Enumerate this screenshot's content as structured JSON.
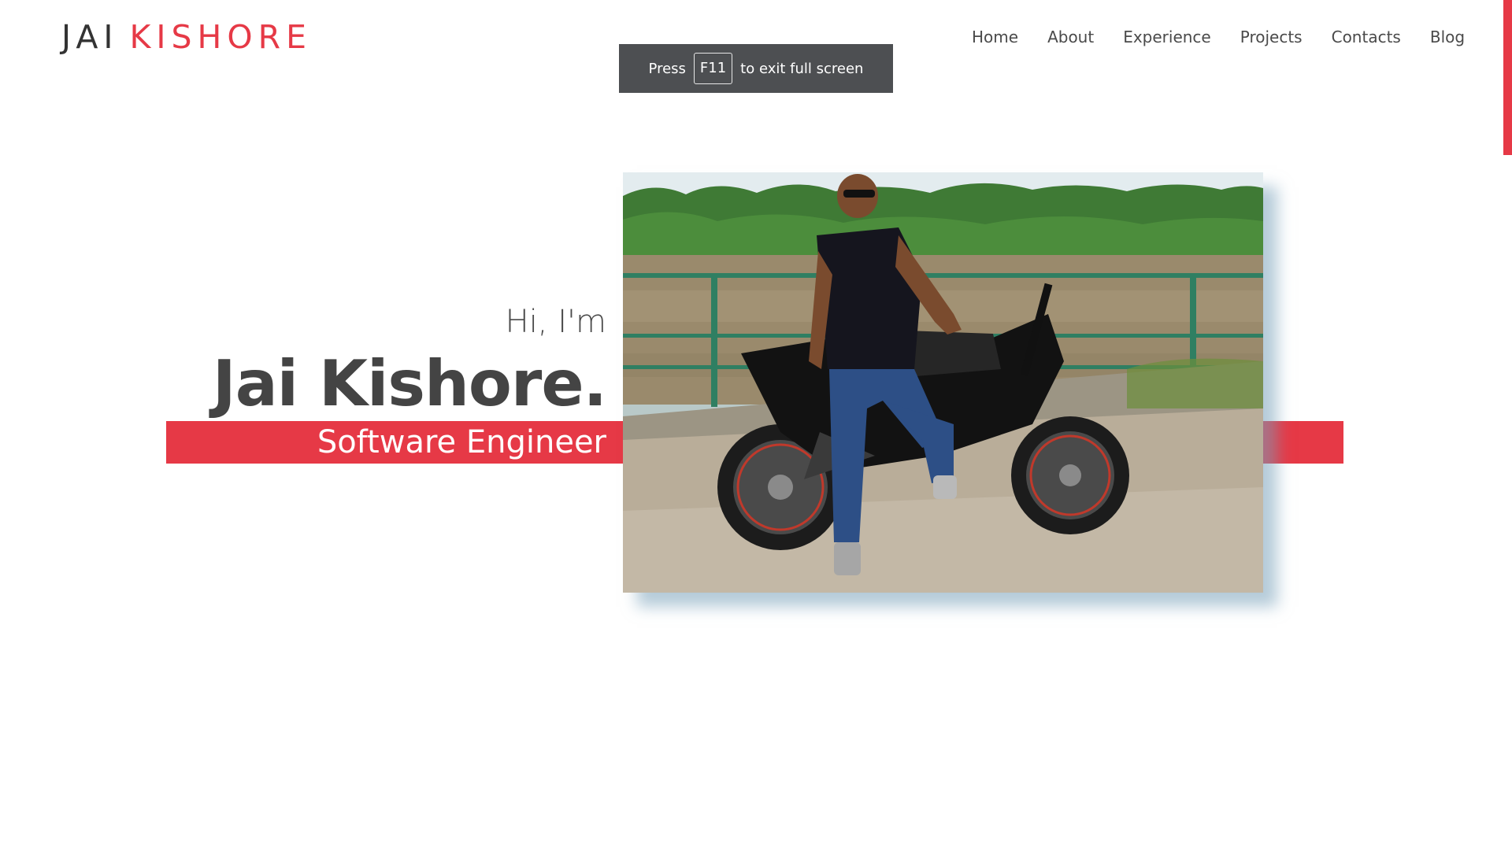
{
  "brand": {
    "first": "JAI",
    "last": "KISHORE"
  },
  "nav": {
    "items": [
      {
        "label": "Home"
      },
      {
        "label": "About"
      },
      {
        "label": "Experience"
      },
      {
        "label": "Projects"
      },
      {
        "label": "Contacts"
      },
      {
        "label": "Blog"
      }
    ]
  },
  "fullscreen_toast": {
    "before": "Press",
    "key": "F11",
    "after": "to exit full screen"
  },
  "hero": {
    "greeting": "Hi, I'm",
    "name": "Jai Kishore.",
    "role": "Software Engineer"
  },
  "colors": {
    "accent": "#e63946",
    "text": "#444444",
    "toast_bg": "#4d4f52"
  }
}
